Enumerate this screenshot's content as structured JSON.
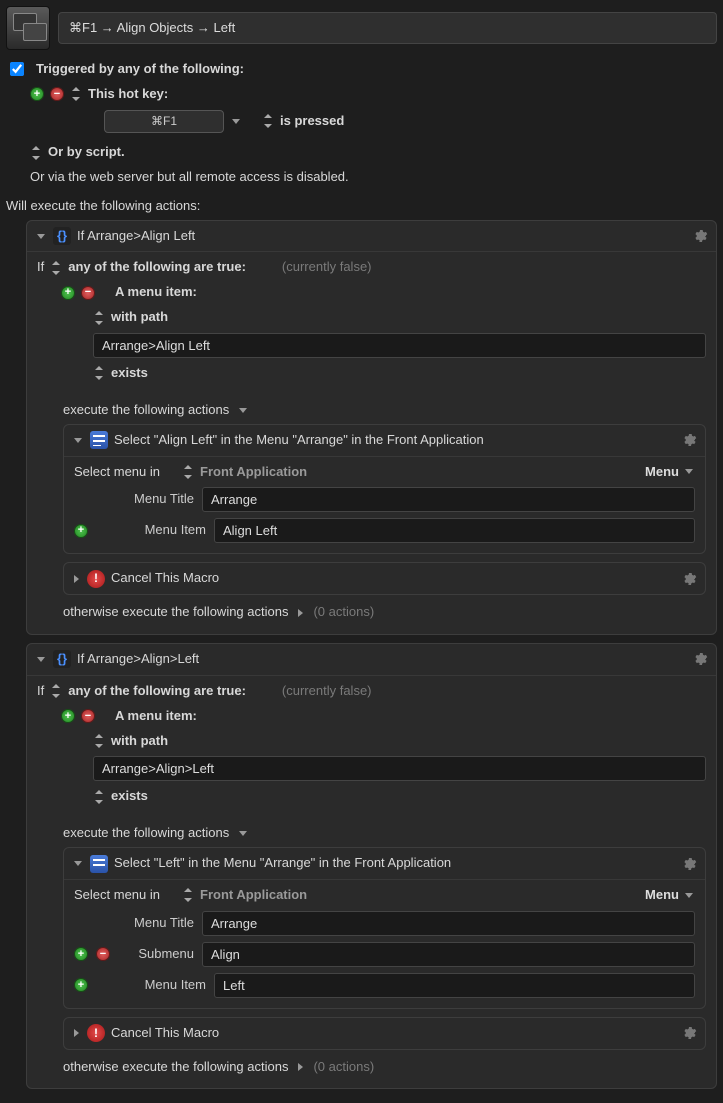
{
  "title": "⌘F1 → Align Objects → Left",
  "triggered_label": "Triggered by any of the following:",
  "hotkey_label": "This hot key:",
  "hotkey_value": "⌘F1",
  "is_pressed": "is pressed",
  "or_script": "Or by script.",
  "or_web": "Or via the web server but all remote access is disabled.",
  "will_execute": "Will execute the following actions:",
  "if_any": "any of the following are true:",
  "currently_false": "(currently false)",
  "menu_item_label": "A menu item:",
  "with_path": "with path",
  "exists": "exists",
  "execute_following": "execute the following actions",
  "otherwise": "otherwise execute the following actions",
  "zero_actions": "(0 actions)",
  "select_menu_in": "Select menu in",
  "front_app": "Front Application",
  "menu_btn": "Menu",
  "menu_title_label": "Menu Title",
  "submenu_label": "Submenu",
  "menu_item_field_label": "Menu Item",
  "cancel_macro": "Cancel This Macro",
  "if_word": "If",
  "block1": {
    "title": "If Arrange>Align Left",
    "path": "Arrange>Align Left",
    "select_title": "Select \"Align Left\" in the Menu \"Arrange\" in the Front Application",
    "menu_title_value": "Arrange",
    "menu_item_value": "Align Left"
  },
  "block2": {
    "title": "If Arrange>Align>Left",
    "path": "Arrange>Align>Left",
    "select_title": "Select \"Left\" in the Menu \"Arrange\" in the Front Application",
    "menu_title_value": "Arrange",
    "submenu_value": "Align",
    "menu_item_value": "Left"
  }
}
